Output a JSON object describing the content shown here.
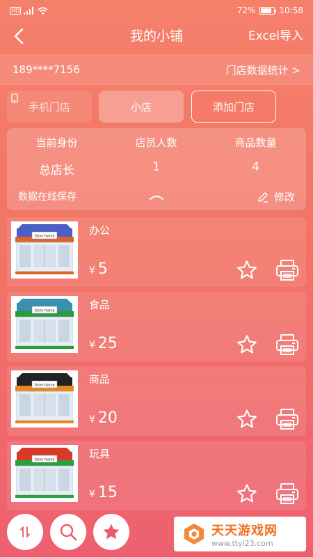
{
  "status_bar": {
    "left": "HD",
    "battery": "72%",
    "time": "10:58"
  },
  "nav": {
    "title": "我的小铺",
    "action": "Excel导入"
  },
  "account": {
    "phone": "189****7156",
    "stats_link": "门店数据统计 >"
  },
  "tabs": {
    "phone_store": "手机门店",
    "small_store": "小店",
    "add_store": "添加门店"
  },
  "summary": {
    "headers": [
      "当前身份",
      "店员人数",
      "商品数量"
    ],
    "values": [
      "总店长",
      "1",
      "4"
    ],
    "footer": "数据在线保存",
    "edit": "修改"
  },
  "items": [
    {
      "name": "办公",
      "currency": "¥",
      "price": "5",
      "accent": "#e0622a",
      "roof": "#4a5fc8"
    },
    {
      "name": "食品",
      "currency": "¥",
      "price": "25",
      "accent": "#2a9a3a",
      "roof": "#3a8fb0"
    },
    {
      "name": "商品",
      "currency": "¥",
      "price": "20",
      "accent": "#e8881e",
      "roof": "#222222"
    },
    {
      "name": "玩具",
      "currency": "¥",
      "price": "15",
      "accent": "#2aa03a",
      "roof": "#d83a2a"
    }
  ],
  "store_sign": "Store Name",
  "watermark": {
    "name": "天天游戏网",
    "url": "www.ttyl23.com"
  },
  "colors": {
    "accent": "#f27466",
    "icon": "#e85a6a"
  }
}
